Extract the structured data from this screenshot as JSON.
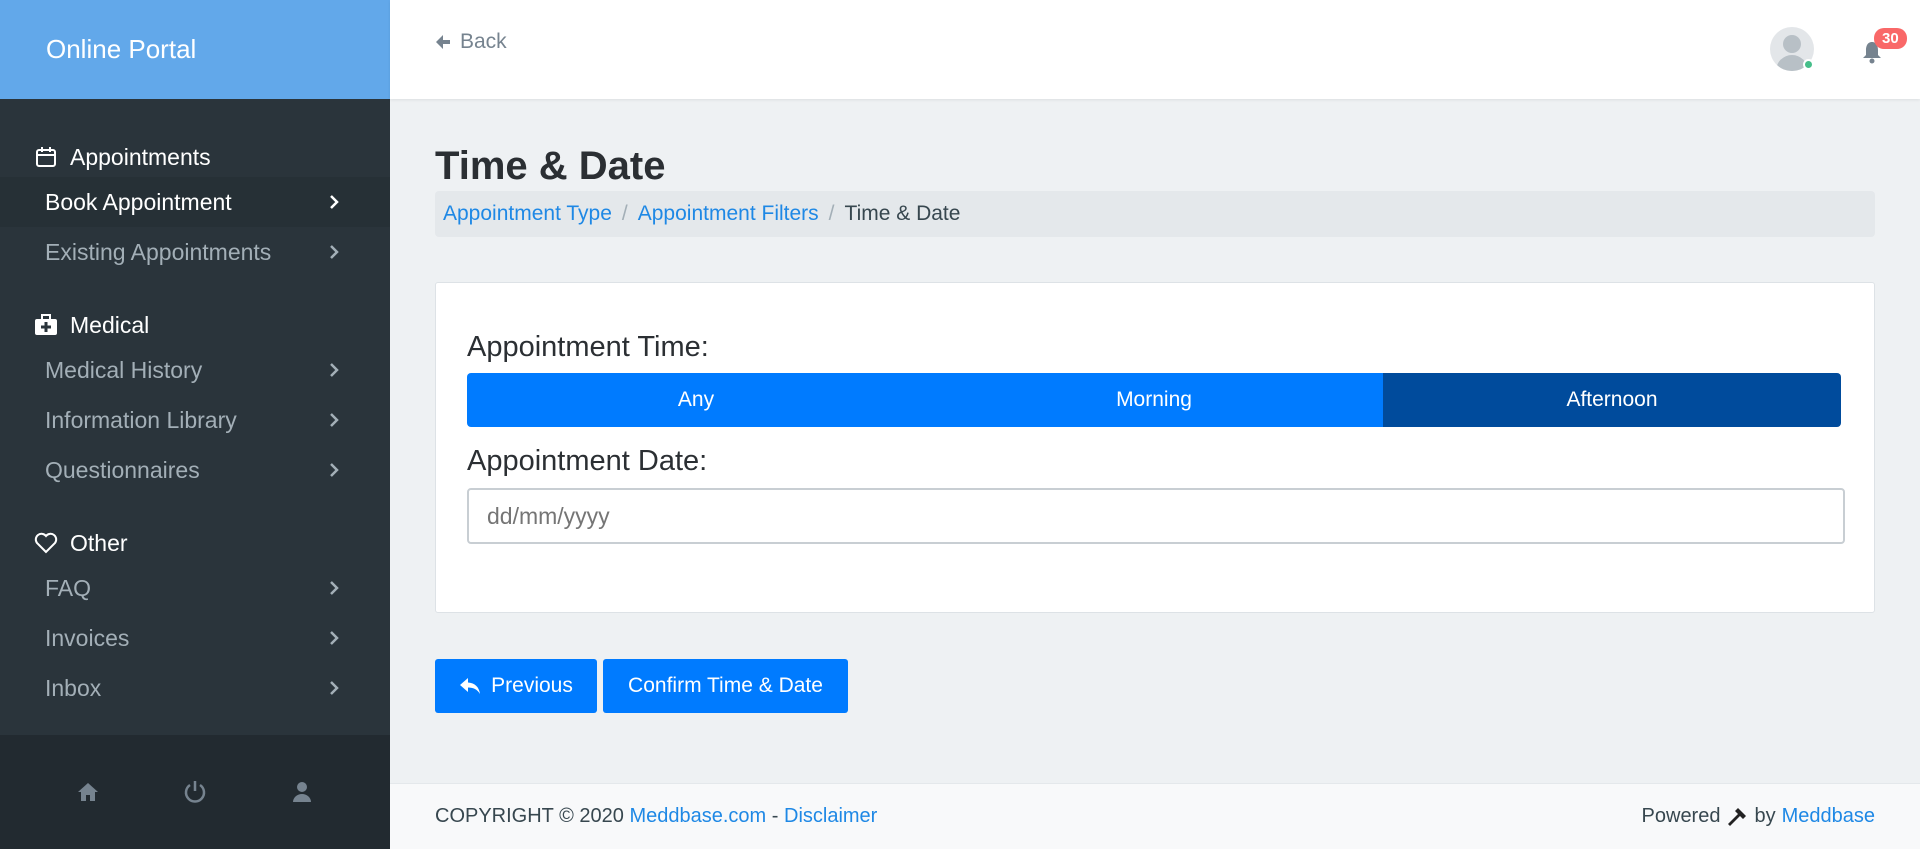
{
  "app": {
    "brand": "Online Portal"
  },
  "sidebar": {
    "sections": [
      {
        "title": "Appointments",
        "icon": "calendar-icon",
        "items": [
          {
            "label": "Book Appointment",
            "active": true
          },
          {
            "label": "Existing Appointments",
            "active": false
          }
        ]
      },
      {
        "title": "Medical",
        "icon": "medkit-icon",
        "items": [
          {
            "label": "Medical History"
          },
          {
            "label": "Information Library"
          },
          {
            "label": "Questionnaires"
          }
        ]
      },
      {
        "title": "Other",
        "icon": "heart-icon",
        "items": [
          {
            "label": "FAQ"
          },
          {
            "label": "Invoices"
          },
          {
            "label": "Inbox"
          }
        ]
      }
    ],
    "footer_icons": [
      "home-icon",
      "power-icon",
      "user-icon"
    ]
  },
  "header": {
    "back_label": "Back",
    "notification_count": "30"
  },
  "page": {
    "title": "Time & Date",
    "breadcrumb": [
      "Appointment Type",
      "Appointment Filters",
      "Time & Date"
    ]
  },
  "form": {
    "time_label": "Appointment Time:",
    "time_options": [
      "Any",
      "Morning",
      "Afternoon"
    ],
    "selected_time": "Afternoon",
    "date_label": "Appointment Date:",
    "date_placeholder": "dd/mm/yyyy"
  },
  "actions": {
    "previous_label": "Previous",
    "confirm_label": "Confirm Time & Date"
  },
  "footer": {
    "copyright": "COPYRIGHT © 2020",
    "site_link": "Meddbase.com",
    "dash": "-",
    "disclaimer": "Disclaimer",
    "powered": "Powered",
    "by": "by",
    "vendor": "Meddbase"
  },
  "colors": {
    "brand_bar": "#62a8ea",
    "sidebar_bg": "#2a343b",
    "primary": "#007bff",
    "selected": "#004b9c",
    "link": "#1e88e5",
    "badge": "#f96868"
  }
}
